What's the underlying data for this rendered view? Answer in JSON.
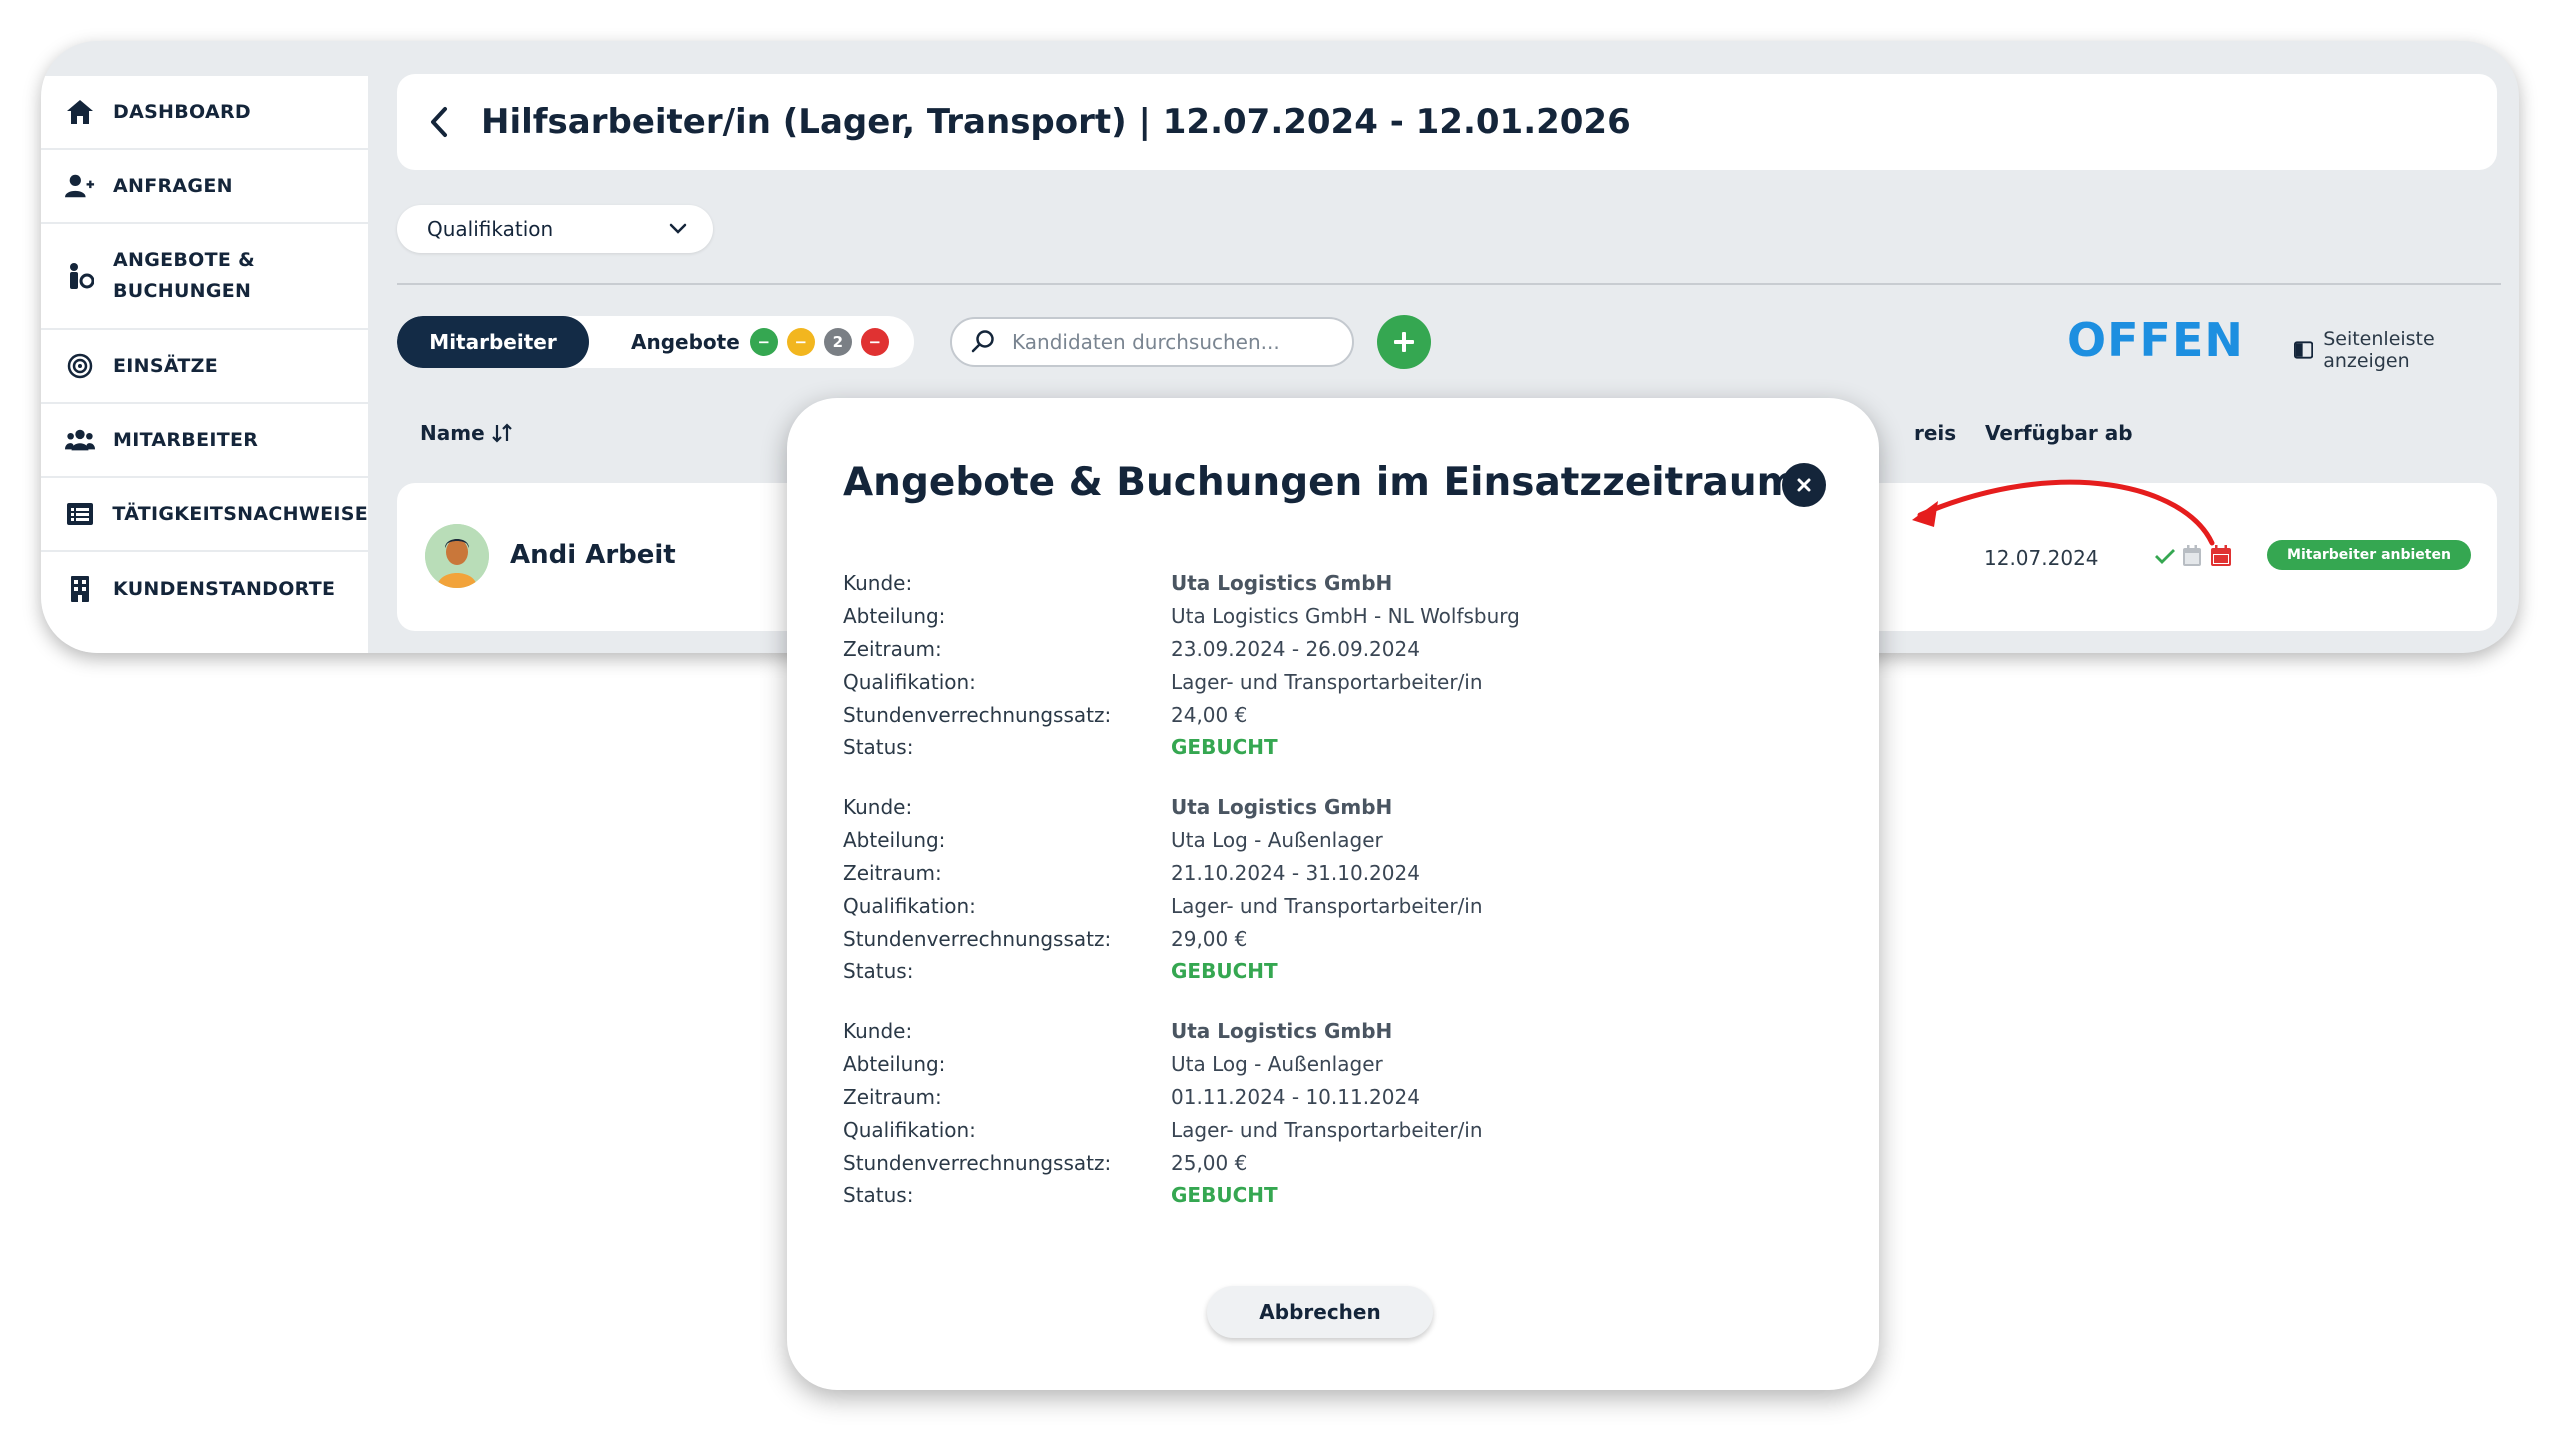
{
  "sidebar": {
    "items": [
      {
        "label": "DASHBOARD",
        "icon": "home-icon"
      },
      {
        "label": "ANFRAGEN",
        "icon": "user-plus-icon"
      },
      {
        "label": "ANGEBOTE &\nBUCHUNGEN",
        "icon": "person-booking-icon"
      },
      {
        "label": "EINSÄTZE",
        "icon": "target-icon"
      },
      {
        "label": "MITARBEITER",
        "icon": "users-icon"
      },
      {
        "label": "TÄTIGKEITSNACHWEISE",
        "icon": "list-icon"
      },
      {
        "label": "KUNDENSTANDORTE",
        "icon": "building-icon"
      }
    ]
  },
  "header": {
    "title": "Hilfsarbeiter/in (Lager, Transport) | 12.07.2024 - 12.01.2026"
  },
  "filters": {
    "qualification_label": "Qualifikation"
  },
  "tabs": {
    "employees": "Mitarbeiter",
    "offers": "Angebote",
    "offer_counts": [
      {
        "color": "#35a751",
        "text": "−"
      },
      {
        "color": "#f2b61f",
        "text": "−"
      },
      {
        "color": "#7a7f85",
        "text": "2"
      },
      {
        "color": "#e03232",
        "text": "−"
      }
    ]
  },
  "search": {
    "placeholder": "Kandidaten durchsuchen..."
  },
  "status": {
    "label": "OFFEN",
    "color": "#1d8fe0"
  },
  "sidebar_toggle": {
    "label": "Seitenleiste anzeigen"
  },
  "table": {
    "columns": {
      "name": "Name",
      "price": "reis",
      "available_from": "Verfügbar ab"
    },
    "rows": [
      {
        "name": "Andi Arbeit",
        "available_from": "12.07.2024",
        "action": "Mitarbeiter anbieten"
      }
    ]
  },
  "modal": {
    "title": "Angebote & Buchungen im Einsatzzeitraum",
    "labels": {
      "customer": "Kunde:",
      "department": "Abteilung:",
      "period": "Zeitraum:",
      "qualification": "Qualifikation:",
      "rate": "Stundenverrechnungssatz:",
      "status": "Status:"
    },
    "bookings": [
      {
        "customer": "Uta Logistics GmbH",
        "department": "Uta Logistics GmbH - NL Wolfsburg",
        "period": "23.09.2024 - 26.09.2024",
        "qualification": "Lager- und Transportarbeiter/in",
        "rate": "24,00 €",
        "status": "GEBUCHT"
      },
      {
        "customer": "Uta Logistics GmbH",
        "department": "Uta Log - Außenlager",
        "period": "21.10.2024 - 31.10.2024",
        "qualification": "Lager- und Transportarbeiter/in",
        "rate": "29,00 €",
        "status": "GEBUCHT"
      },
      {
        "customer": "Uta Logistics GmbH",
        "department": "Uta Log - Außenlager",
        "period": "01.11.2024 - 10.11.2024",
        "qualification": "Lager- und Transportarbeiter/in",
        "rate": "25,00 €",
        "status": "GEBUCHT"
      }
    ],
    "cancel_label": "Abbrechen"
  },
  "colors": {
    "navy": "#132b46",
    "green": "#35a751",
    "red": "#e03232",
    "background": "#e8ebee"
  }
}
